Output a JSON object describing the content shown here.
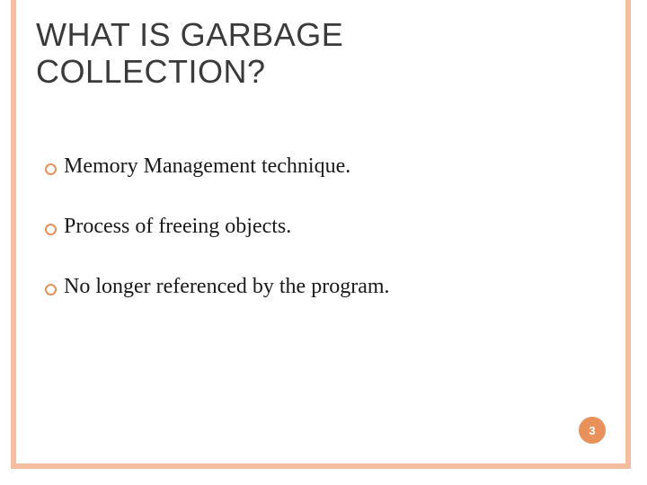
{
  "title": "WHAT IS GARBAGE COLLECTION?",
  "bullets": [
    "Memory Management technique.",
    "Process of freeing objects.",
    "No longer referenced by the program."
  ],
  "page_number": "3"
}
